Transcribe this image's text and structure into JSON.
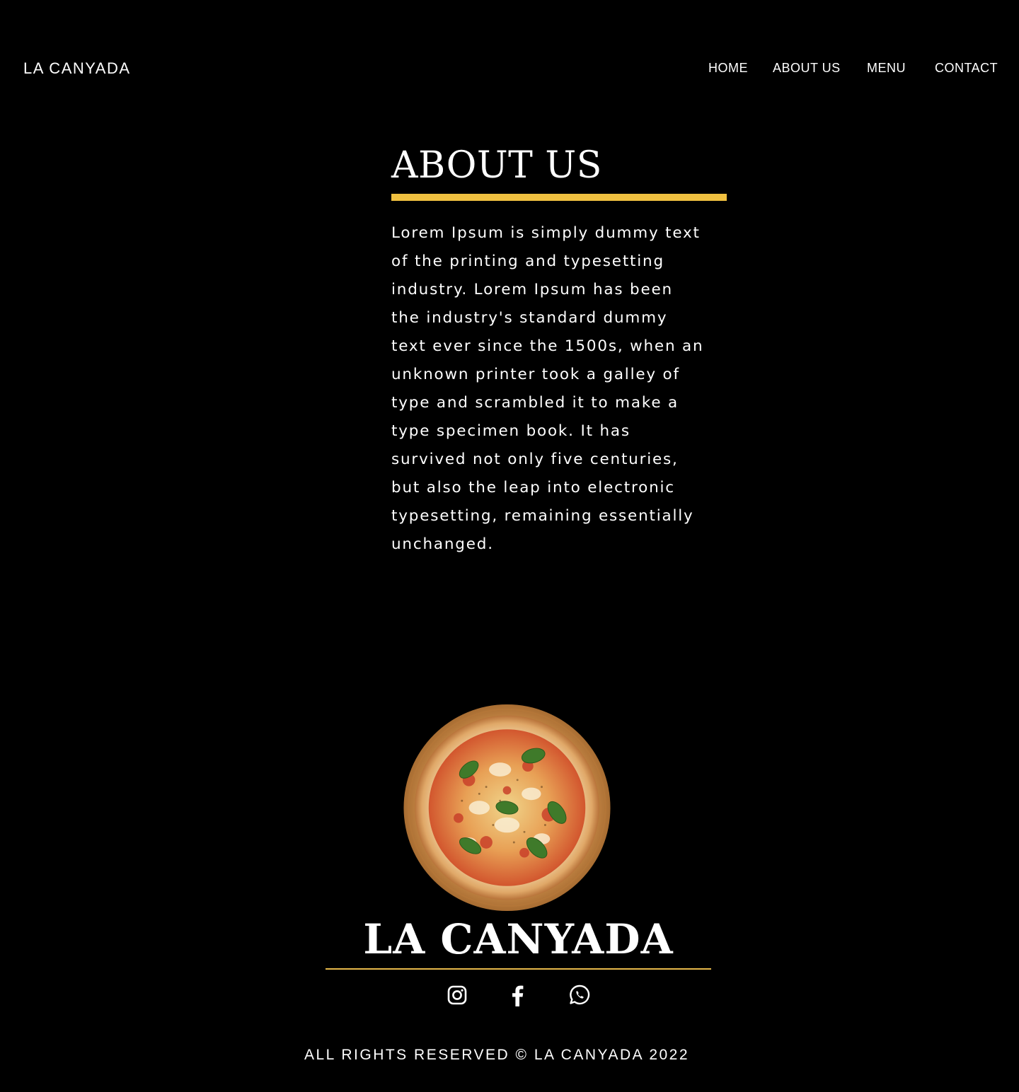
{
  "header": {
    "brand": "LA CANYADA",
    "nav": [
      {
        "label": "HOME"
      },
      {
        "label": "ABOUT US"
      },
      {
        "label": "MENU"
      },
      {
        "label": "CONTACT"
      }
    ]
  },
  "about": {
    "title": "ABOUT US",
    "accent_color": "#f0c040",
    "paragraph_lines": [
      "Lorem Ipsum is simply dummy text",
      "of the printing and typesetting",
      "industry. Lorem Ipsum has been",
      "the industry's standard dummy",
      "text ever since the 1500s, when an",
      "unknown printer took a galley of",
      "type and scrambled it to make a",
      "type specimen book. It has",
      "survived not only five centuries,",
      "but also the leap into electronic",
      "typesetting, remaining essentially",
      "unchanged."
    ]
  },
  "footer": {
    "image_icon": "pizza-image",
    "brand": "LA CANYADA",
    "rule_color": "#e6b84a",
    "social": [
      {
        "icon": "instagram-icon"
      },
      {
        "icon": "facebook-icon"
      },
      {
        "icon": "whatsapp-icon"
      }
    ],
    "copyright": "ALL RIGHTS RESERVED © LA CANYADA 2022"
  }
}
